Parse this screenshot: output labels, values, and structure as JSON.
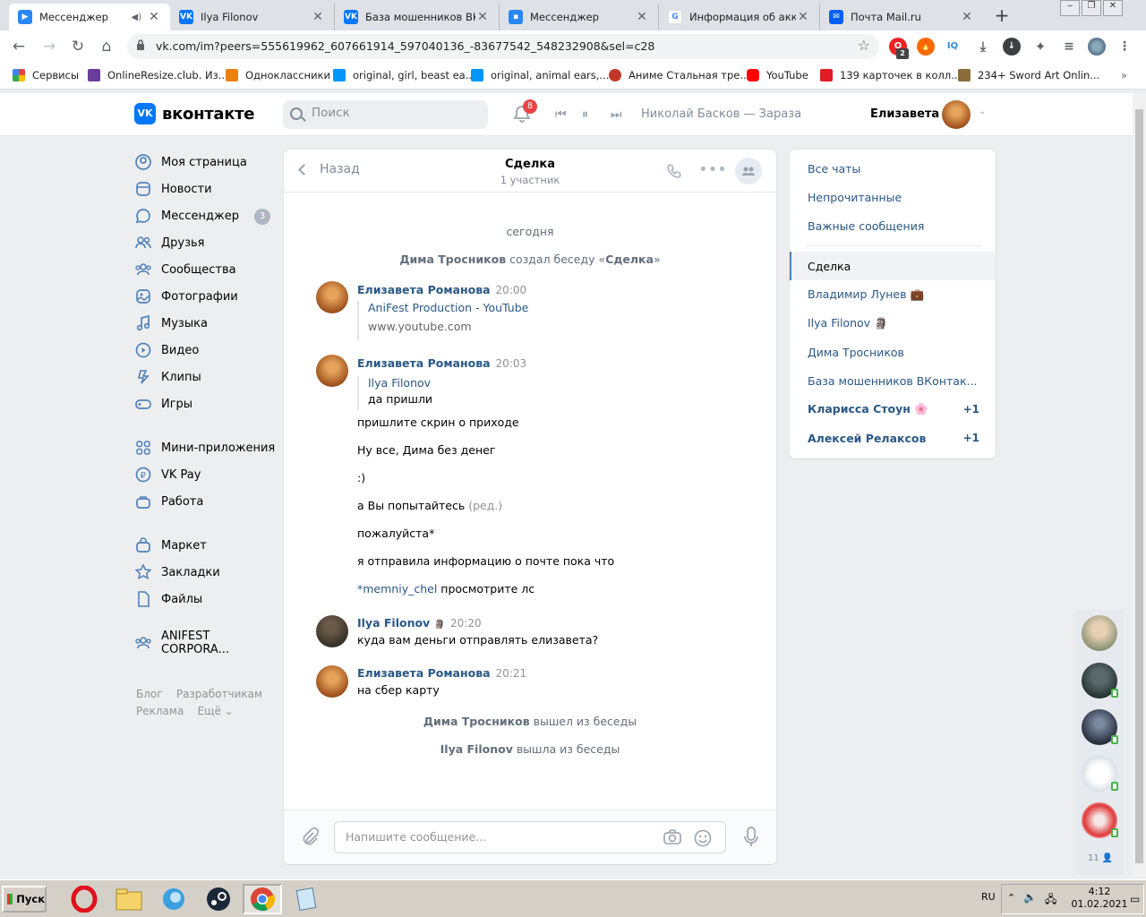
{
  "browser": {
    "tabs": [
      {
        "title": "Мессенджер",
        "icon": "vk-messenger-icon",
        "color": "#2787f5",
        "active": true,
        "audio": true
      },
      {
        "title": "Ilya Filonov",
        "icon": "vk-icon",
        "color": "#0077ff"
      },
      {
        "title": "База мошенников ВКон",
        "icon": "vk-icon",
        "color": "#0077ff"
      },
      {
        "title": "Мессенджер",
        "icon": "vk-messenger-icon",
        "color": "#2787f5"
      },
      {
        "title": "Информация об аккаун",
        "icon": "google-icon",
        "color": "#4285f4"
      },
      {
        "title": "Почта Mail.ru",
        "icon": "mail-icon",
        "color": "#005ff9"
      }
    ],
    "url": "vk.com/im?peers=555619962_607661914_597040136_-83677542_548232908&sel=c28",
    "bookmarks": [
      {
        "label": "Сервисы",
        "color": "#ea4335"
      },
      {
        "label": "OnlineResize.club. Из...",
        "color": "#6a3d9a"
      },
      {
        "label": "Одноклассники",
        "color": "#ee8208"
      },
      {
        "label": "original, girl, beast ea...",
        "color": "#0096fa"
      },
      {
        "label": "original, animal ears,...",
        "color": "#0096fa"
      },
      {
        "label": "Аниме Стальная тре...",
        "color": "#c0392b"
      },
      {
        "label": "YouTube",
        "color": "#ff0000"
      },
      {
        "label": "139 карточек в колл...",
        "color": "#e31b23"
      },
      {
        "label": "234+ Sword Art Onlin...",
        "color": "#8a6d3b"
      }
    ],
    "ext_badge": "2"
  },
  "vk": {
    "logo": "вконтакте",
    "search_placeholder": "Поиск",
    "notif_count": "8",
    "track": "Николай Басков — Зараза",
    "user": "Елизавета",
    "nav": [
      {
        "label": "Моя страница",
        "icon": "user-icon"
      },
      {
        "label": "Новости",
        "icon": "news-icon"
      },
      {
        "label": "Мессенджер",
        "icon": "message-icon",
        "count": "3"
      },
      {
        "label": "Друзья",
        "icon": "friends-icon"
      },
      {
        "label": "Сообщества",
        "icon": "communities-icon"
      },
      {
        "label": "Фотографии",
        "icon": "photo-icon"
      },
      {
        "label": "Музыка",
        "icon": "music-icon"
      },
      {
        "label": "Видео",
        "icon": "video-icon"
      },
      {
        "label": "Клипы",
        "icon": "clips-icon"
      },
      {
        "label": "Игры",
        "icon": "games-icon"
      },
      {
        "label": "Мини-приложения",
        "icon": "apps-icon"
      },
      {
        "label": "VK Pay",
        "icon": "vkpay-icon"
      },
      {
        "label": "Работа",
        "icon": "work-icon"
      },
      {
        "label": "Маркет",
        "icon": "market-icon"
      },
      {
        "label": "Закладки",
        "icon": "bookmark-icon"
      },
      {
        "label": "Файлы",
        "icon": "files-icon"
      },
      {
        "label": "ANIFEST CORPORA...",
        "icon": "communities-icon"
      }
    ],
    "footer": {
      "blog": "Блог",
      "dev": "Разработчикам",
      "ads": "Реклама",
      "more": "Ещё"
    }
  },
  "chat": {
    "back": "Назад",
    "title": "Сделка",
    "subtitle": "1 участник",
    "date": "сегодня",
    "created": {
      "who": "Дима Тросников",
      "text": "создал беседу «",
      "name": "Сделка",
      "end": "»"
    },
    "m1": {
      "author": "Елизавета Романова",
      "time": "20:00",
      "link_title": "AniFest Production - YouTube",
      "link_url": "www.youtube.com"
    },
    "m2": {
      "author": "Елизавета Романова",
      "time": "20:03",
      "quote_author": "Ilya Filonov",
      "quote_text": "да пришли",
      "lines": [
        "пришлите скрин о приходе",
        "Ну все, Дима без денег",
        ":)",
        "а Вы попытайтесь",
        "пожалуйста*",
        "я отправила информацию о почте пока что"
      ],
      "edited": "(ред.)",
      "mention": "*memniy_chel",
      "mention_rest": " просмотрите лс"
    },
    "m3": {
      "author": "Ilya Filonov",
      "time": "20:20",
      "text": "куда вам деньги отправлять елизавета?"
    },
    "m4": {
      "author": "Елизавета Романова",
      "time": "20:21",
      "text": "на сбер карту"
    },
    "left1": {
      "who": "Дима Тросников",
      "text": " вышел из беседы"
    },
    "left2": {
      "who": "Ilya Filonov",
      "text": " вышла из беседы"
    },
    "composer_placeholder": "Напишите сообщение..."
  },
  "rmenu": {
    "all": "Все чаты",
    "unread": "Непрочитанные",
    "important": "Важные сообщения",
    "chats": [
      {
        "label": "Сделка",
        "active": true
      },
      {
        "label": "Владимир Лунев 💼"
      },
      {
        "label": "Ilya Filonov 🗿"
      },
      {
        "label": "Дима Тросников"
      },
      {
        "label": "База мошенников ВКонтак..."
      },
      {
        "label": "Кларисса Стоун 🌸",
        "plus": "+1"
      },
      {
        "label": "Алексей Релаксов",
        "plus": "+1"
      }
    ]
  },
  "friends_count": "11",
  "taskbar": {
    "start": "Пуск",
    "lang": "RU",
    "time": "4:12",
    "date": "01.02.2021"
  }
}
